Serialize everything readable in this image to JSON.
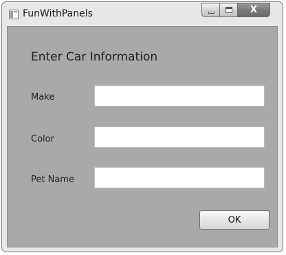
{
  "window": {
    "title": "FunWithPanels",
    "icon": "window-app-icon",
    "caption_buttons": [
      "minimize-icon",
      "maximize-icon",
      "close-icon"
    ],
    "close_glyph": "X"
  },
  "form": {
    "heading": "Enter Car Information",
    "fields": [
      {
        "label": "Make",
        "value": ""
      },
      {
        "label": "Color",
        "value": ""
      },
      {
        "label": "Pet Name",
        "value": ""
      }
    ],
    "ok_label": "OK"
  },
  "colors": {
    "client_background": "#a9a9a9",
    "window_frame": "#e7e7e7",
    "close_button": "#7a7a7a"
  }
}
